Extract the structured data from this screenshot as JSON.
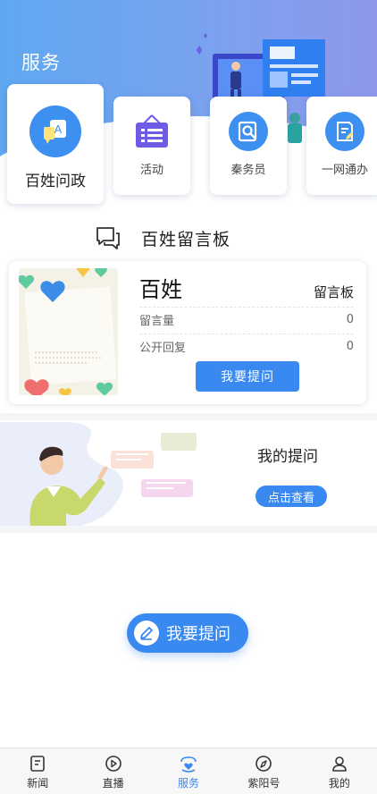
{
  "header": {
    "title": "服务"
  },
  "services": [
    {
      "label": "百姓问政",
      "icon": "chat-a-icon"
    },
    {
      "label": "活动",
      "icon": "signboard-icon"
    },
    {
      "label": "秦务员",
      "icon": "search-doc-icon"
    },
    {
      "label": "一网通办",
      "icon": "document-leaf-icon"
    }
  ],
  "board": {
    "title": "百姓留言板",
    "icon": "chat-bubbles-icon",
    "name": "百姓",
    "tag": "留言板",
    "stats": [
      {
        "label": "留言量",
        "value": "0"
      },
      {
        "label": "公开回复",
        "value": "0"
      }
    ],
    "ask_button": "我要提问"
  },
  "my_question": {
    "title": "我的提问",
    "button": "点击查看"
  },
  "floating": {
    "label": "我要提问",
    "icon": "edit-icon"
  },
  "tabs": [
    {
      "label": "新闻",
      "icon": "news-icon",
      "active": false
    },
    {
      "label": "直播",
      "icon": "play-icon",
      "active": false
    },
    {
      "label": "服务",
      "icon": "service-heart-icon",
      "active": true
    },
    {
      "label": "紫阳号",
      "icon": "compass-icon",
      "active": false
    },
    {
      "label": "我的",
      "icon": "user-icon",
      "active": false
    }
  ],
  "colors": {
    "primary": "#3a89f0",
    "header_start": "#5fa8f0",
    "header_end": "#8f98e9"
  }
}
